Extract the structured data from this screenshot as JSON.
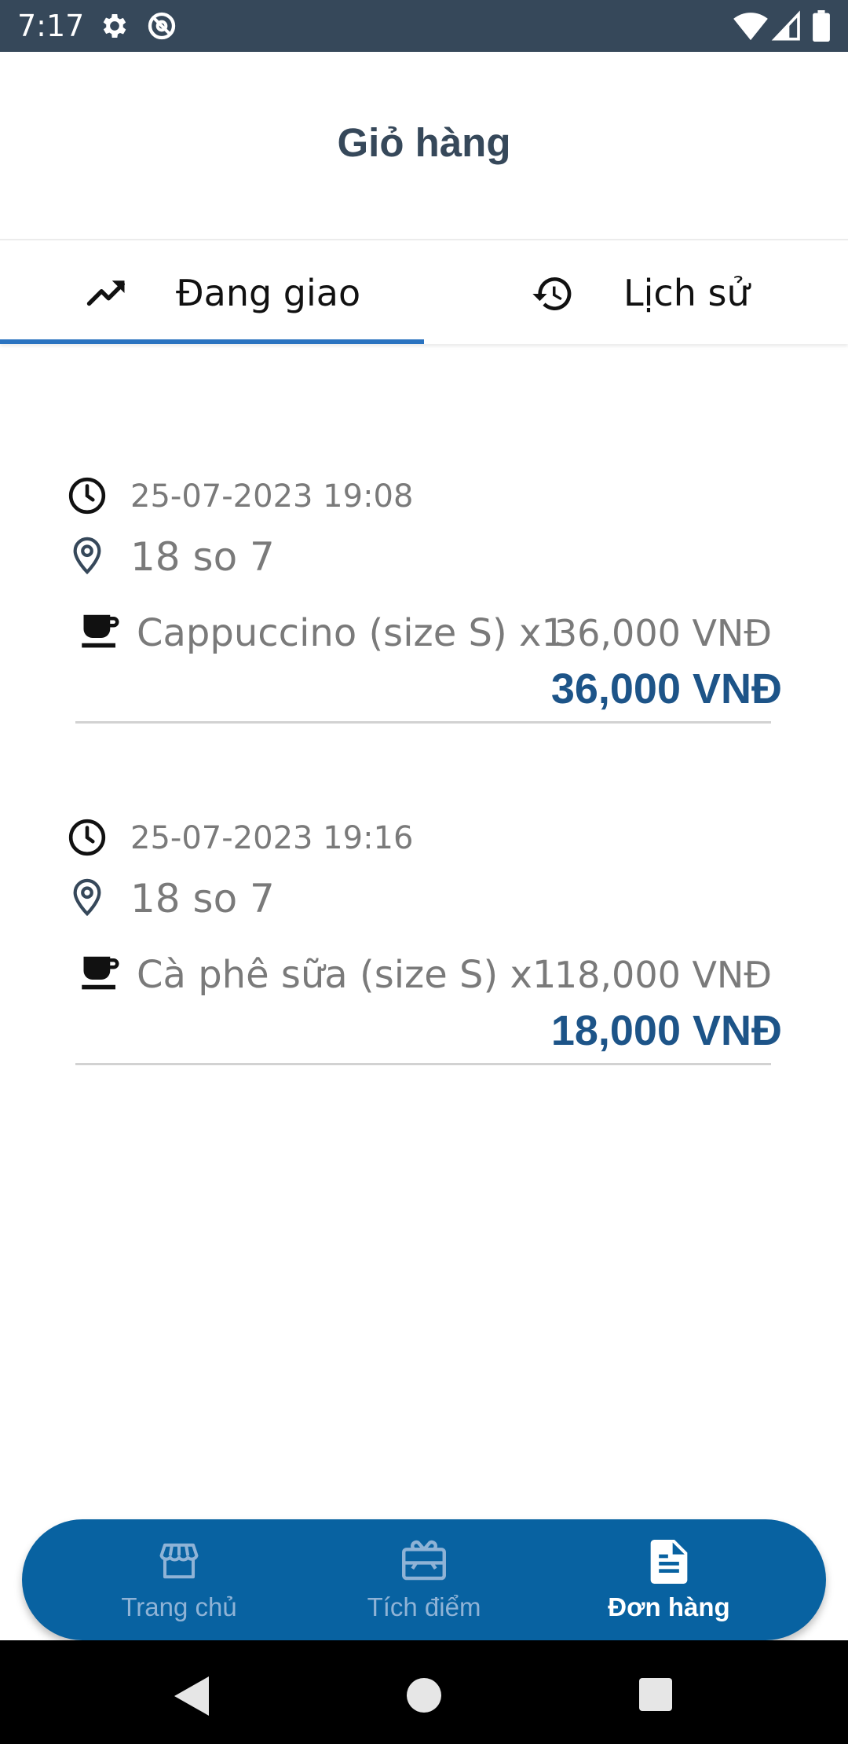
{
  "status_bar": {
    "time": "7:17"
  },
  "header": {
    "title": "Giỏ hàng"
  },
  "tabs": [
    {
      "label": "Đang giao",
      "icon": "trending-up-icon",
      "active": true
    },
    {
      "label": "Lịch sử",
      "icon": "history-icon",
      "active": false
    }
  ],
  "orders": [
    {
      "datetime": "25-07-2023 19:08",
      "address": "18 so 7",
      "item_name": "Cappuccino (size S) x1",
      "item_price": "36,000 VNĐ",
      "total": "36,000 VNĐ"
    },
    {
      "datetime": "25-07-2023 19:16",
      "address": "18 so 7",
      "item_name": "Cà phê sữa (size S) x1",
      "item_price": "18,000 VNĐ",
      "total": "18,000 VNĐ"
    }
  ],
  "bottom_nav": [
    {
      "label": "Trang chủ",
      "icon": "store-icon",
      "active": false
    },
    {
      "label": "Tích điểm",
      "icon": "gift-card-icon",
      "active": false
    },
    {
      "label": "Đơn hàng",
      "icon": "document-icon",
      "active": true
    }
  ],
  "colors": {
    "status_bar": "#36485a",
    "title": "#36485a",
    "tab_indicator": "#2a73c0",
    "total": "#1d5488",
    "nav_background": "#0862a1",
    "nav_inactive": "#8fb3d6",
    "nav_active": "#ffffff"
  }
}
